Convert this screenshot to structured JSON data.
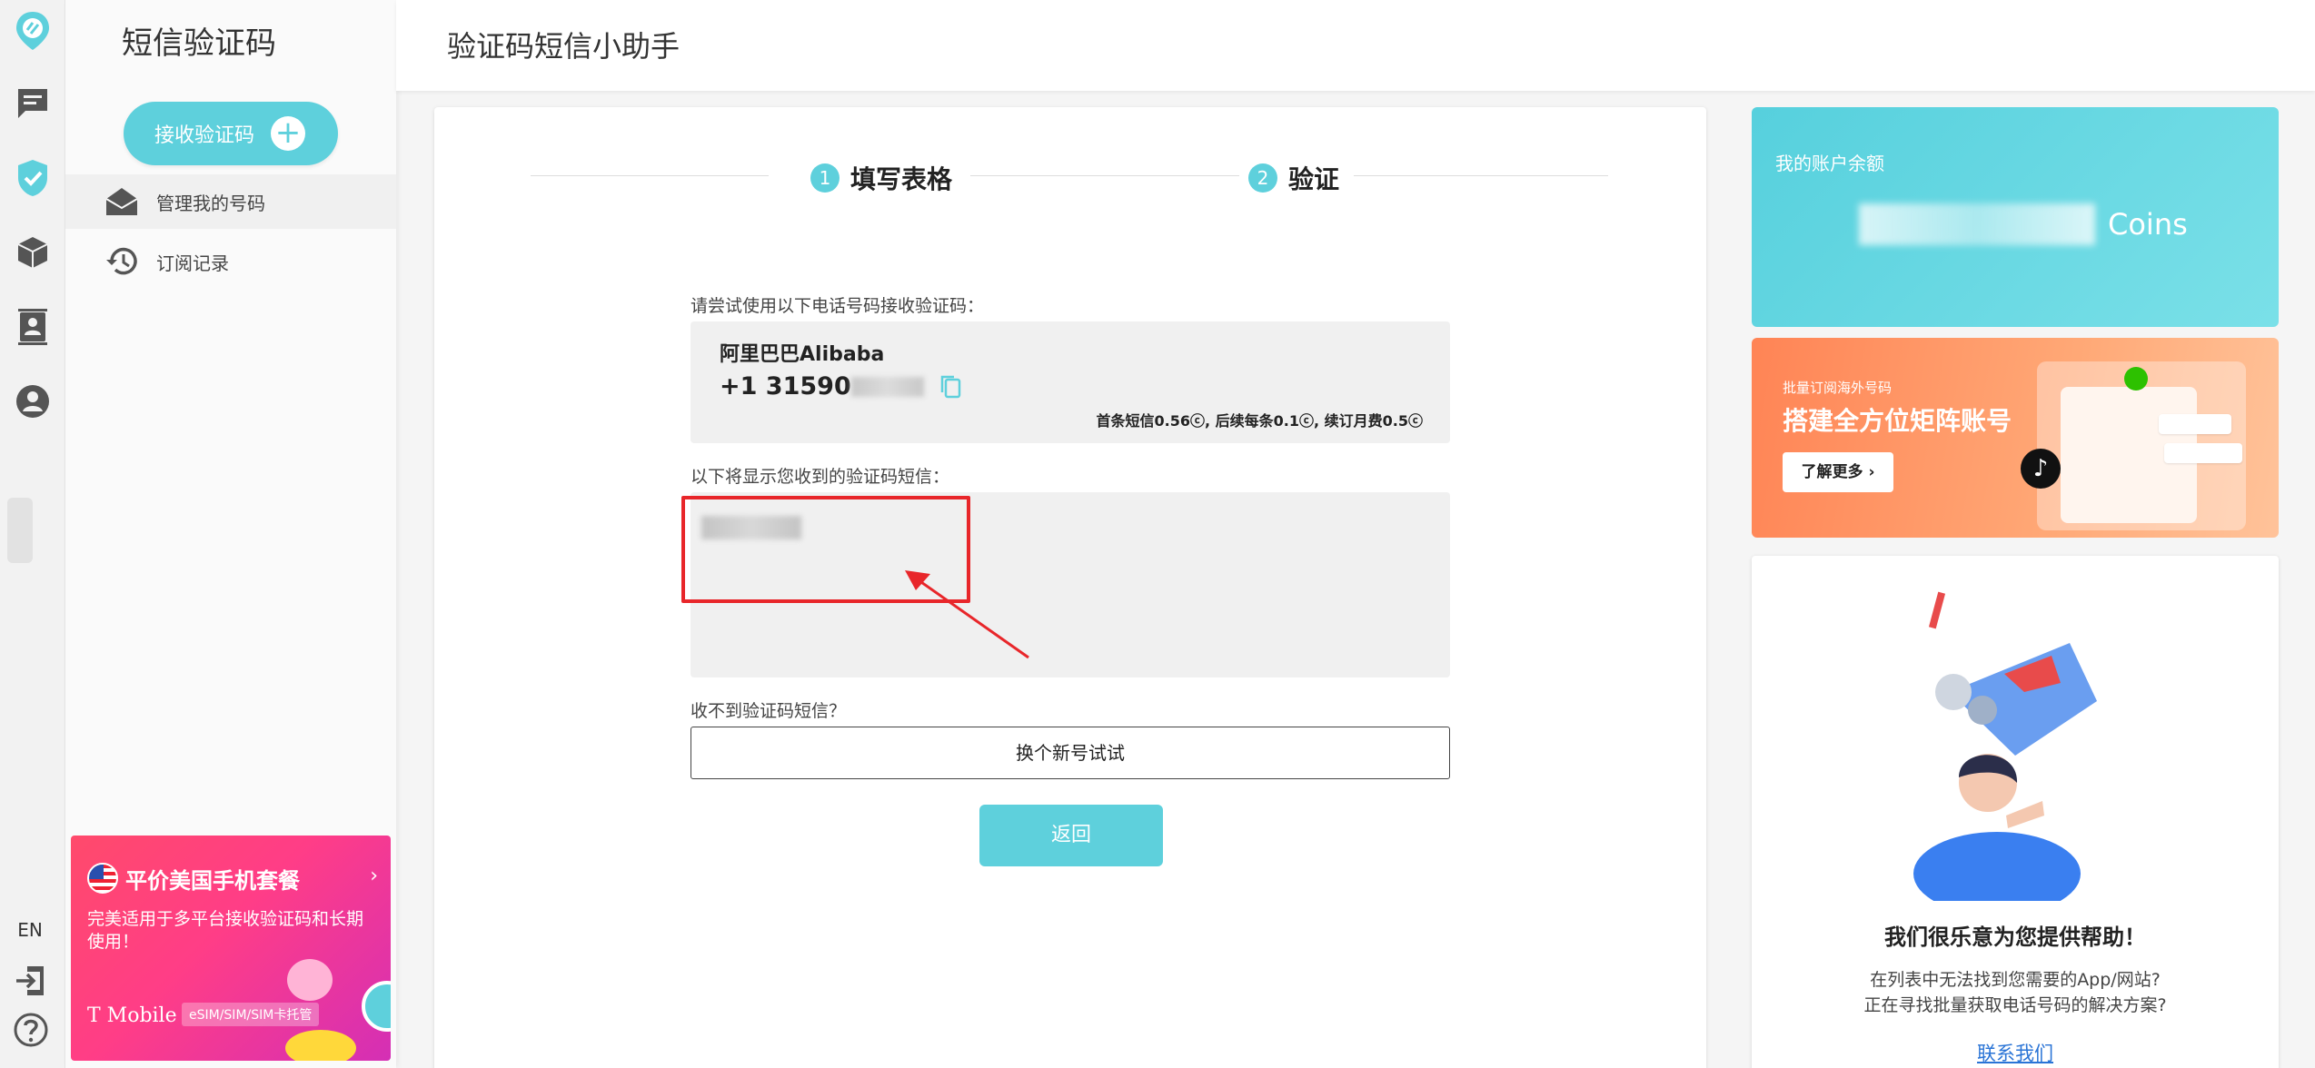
{
  "rail": {
    "icons": [
      "logo-icon",
      "chat-icon",
      "shield-check-icon",
      "package-icon",
      "contacts-icon",
      "account-icon"
    ],
    "lang": "EN",
    "bottom_icons": [
      "logout-icon",
      "help-icon"
    ]
  },
  "sidebar": {
    "title": "短信验证码",
    "receive_button": "接收验证码",
    "items": [
      {
        "label": "管理我的号码",
        "icon": "envelope-open-icon"
      },
      {
        "label": "订阅记录",
        "icon": "history-icon"
      }
    ],
    "promo": {
      "title": "平价美国手机套餐",
      "description": "完美适用于多平台接收验证码和长期使用！",
      "brand": "T Mobile",
      "tag": "eSIM/SIM/SIM卡托管"
    }
  },
  "header": {
    "title": "验证码短信小助手"
  },
  "steps": [
    {
      "num": "1",
      "label": "填写表格"
    },
    {
      "num": "2",
      "label": "验证"
    }
  ],
  "form": {
    "number_label": "请尝试使用以下电话号码接收验证码：",
    "service_name": "阿里巴巴Alibaba",
    "phone_prefix": "+1 31590",
    "price_note": "首条短信0.56ⓒ, 后续每条0.1ⓒ, 续订月费0.5ⓒ",
    "sms_label": "以下将显示您收到的验证码短信：",
    "no_sms_label": "收不到验证码短信？",
    "switch_button": "换个新号试试",
    "back_button": "返回"
  },
  "balance": {
    "label": "我的账户余额",
    "unit": "Coins"
  },
  "ad": {
    "small_text": "批量订阅海外号码",
    "title": "搭建全方位矩阵账号",
    "button": "了解更多"
  },
  "help": {
    "title": "我们很乐意为您提供帮助！",
    "line1": "在列表中无法找到您需要的App/网站?",
    "line2": "正在寻找批量获取电话号码的解决方案?",
    "link": "联系我们"
  },
  "colors": {
    "accent": "#5ed0dc",
    "highlight": "#e8262a",
    "link": "#2a74d6"
  }
}
